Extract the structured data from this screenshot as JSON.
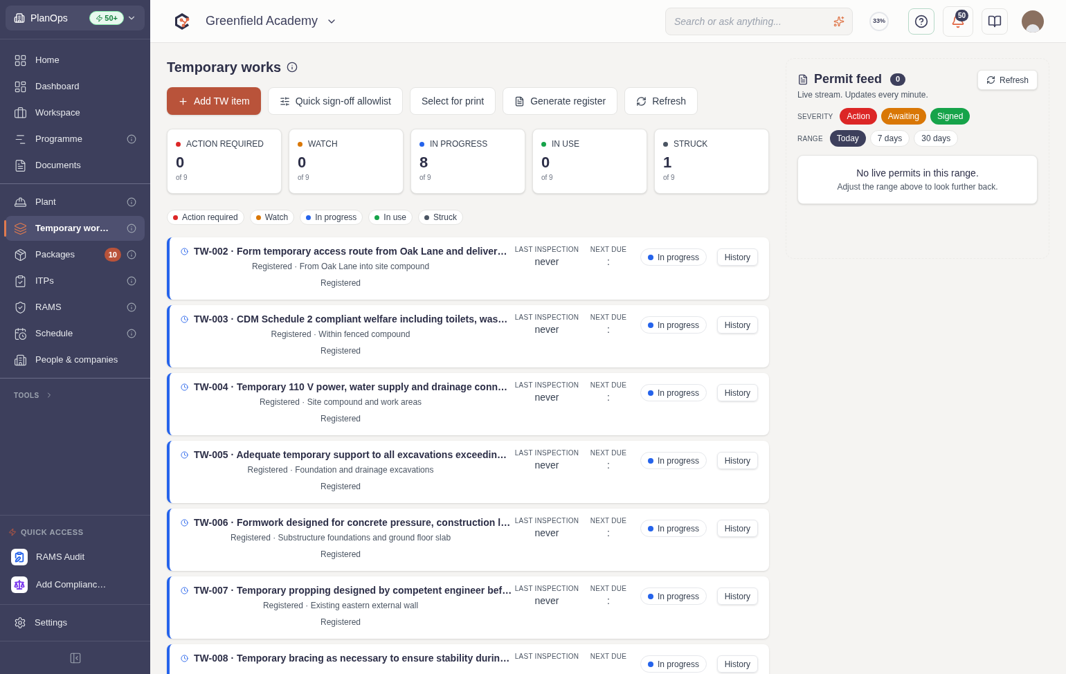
{
  "sidebar": {
    "org": "PlanOps",
    "org_badge": "50+",
    "nav_groups": [
      [
        {
          "label": "Home",
          "info": false,
          "selected": false
        },
        {
          "label": "Dashboard",
          "info": false,
          "selected": false
        },
        {
          "label": "Workspace",
          "info": false,
          "selected": false
        },
        {
          "label": "Programme",
          "info": true,
          "selected": false
        },
        {
          "label": "Documents",
          "info": false,
          "selected": false
        }
      ],
      [
        {
          "label": "Plant",
          "info": true,
          "selected": false
        },
        {
          "label": "Temporary wor…",
          "info": true,
          "selected": true
        },
        {
          "label": "Packages",
          "info": true,
          "selected": false,
          "badge": "10"
        },
        {
          "label": "ITPs",
          "info": true,
          "selected": false
        },
        {
          "label": "RAMS",
          "info": true,
          "selected": false
        },
        {
          "label": "Schedule",
          "info": true,
          "selected": false
        },
        {
          "label": "People & companies",
          "info": false,
          "selected": false
        }
      ]
    ],
    "tools_label": "TOOLS",
    "quick_access_label": "QUICK ACCESS",
    "quick_access": [
      {
        "label": "RAMS Audit",
        "color": "#2563eb"
      },
      {
        "label": "Add Complianc…",
        "color": "#7c3aed"
      }
    ],
    "settings": "Settings"
  },
  "header": {
    "project": "Greenfield Academy",
    "search": {
      "placeholder": "Search or ask anything..."
    },
    "progress": "33%",
    "notifications": "50"
  },
  "page": {
    "title": "Temporary works",
    "actions": [
      {
        "label": "Add TW item",
        "kind": "primary"
      },
      {
        "label": "Quick sign-off allowlist",
        "kind": "secondary"
      },
      {
        "label": "Select for print",
        "kind": "secondary"
      },
      {
        "label": "Generate register",
        "kind": "secondary"
      },
      {
        "label": "Refresh",
        "kind": "secondary"
      }
    ],
    "stats": [
      {
        "label": "ACTION REQUIRED",
        "value": "0",
        "total": "of 9",
        "color": "#dc2626"
      },
      {
        "label": "WATCH",
        "value": "0",
        "total": "of 9",
        "color": "#d97706"
      },
      {
        "label": "IN PROGRESS",
        "value": "8",
        "total": "of 9",
        "color": "#2563eb"
      },
      {
        "label": "IN USE",
        "value": "0",
        "total": "of 9",
        "color": "#16a34a"
      },
      {
        "label": "STRUCK",
        "value": "1",
        "total": "of 9",
        "color": "#4b5563"
      }
    ],
    "filters": [
      {
        "label": "Action required",
        "color": "#dc2626"
      },
      {
        "label": "Watch",
        "color": "#d97706"
      },
      {
        "label": "In progress",
        "color": "#2563eb"
      },
      {
        "label": "In use",
        "color": "#16a34a"
      },
      {
        "label": "Struck",
        "color": "#4b5563"
      }
    ],
    "items": [
      {
        "title": "TW-002 · Form temporary access route from Oak Lane and deliver…",
        "subtitle": "Registered · From Oak Lane into site compound",
        "stage": "Registered",
        "last_label": "LAST INSPECTION",
        "last": "never",
        "next_label": "NEXT DUE",
        "next": ":",
        "status": "In progress",
        "history": "History"
      },
      {
        "title": "TW-003 · CDM Schedule 2 compliant welfare including toilets, was…",
        "subtitle": "Registered · Within fenced compound",
        "stage": "Registered",
        "last_label": "LAST INSPECTION",
        "last": "never",
        "next_label": "NEXT DUE",
        "next": ":",
        "status": "In progress",
        "history": "History"
      },
      {
        "title": "TW-004 · Temporary 110 V power, water supply and drainage conn…",
        "subtitle": "Registered · Site compound and work areas",
        "stage": "Registered",
        "last_label": "LAST INSPECTION",
        "last": "never",
        "next_label": "NEXT DUE",
        "next": ":",
        "status": "In progress",
        "history": "History"
      },
      {
        "title": "TW-005 · Adequate temporary support to all excavations exceedin…",
        "subtitle": "Registered · Foundation and drainage excavations",
        "stage": "Registered",
        "last_label": "LAST INSPECTION",
        "last": "never",
        "next_label": "NEXT DUE",
        "next": ":",
        "status": "In progress",
        "history": "History"
      },
      {
        "title": "TW-006 · Formwork designed for concrete pressure, construction l…",
        "subtitle": "Registered · Substructure foundations and ground floor slab",
        "stage": "Registered",
        "last_label": "LAST INSPECTION",
        "last": "never",
        "next_label": "NEXT DUE",
        "next": ":",
        "status": "In progress",
        "history": "History"
      },
      {
        "title": "TW-007 · Temporary propping designed by competent engineer bef…",
        "subtitle": "Registered · Existing eastern external wall",
        "stage": "Registered",
        "last_label": "LAST INSPECTION",
        "last": "never",
        "next_label": "NEXT DUE",
        "next": ":",
        "status": "In progress",
        "history": "History"
      },
      {
        "title": "TW-008 · Temporary bracing as necessary to ensure stability durin…",
        "last_label": "LAST INSPECTION",
        "next_label": "NEXT DUE",
        "status": "In progress",
        "history": "History"
      }
    ]
  },
  "permit_feed": {
    "title": "Permit feed",
    "count": "0",
    "subtitle": "Live stream. Updates every minute.",
    "refresh": "Refresh",
    "severity_label": "SEVERITY",
    "severities": [
      {
        "label": "Action",
        "color": "#dc2626"
      },
      {
        "label": "Awaiting",
        "color": "#d97706"
      },
      {
        "label": "Signed",
        "color": "#16a34a"
      }
    ],
    "range_label": "RANGE",
    "ranges": [
      {
        "label": "Today",
        "selected": true
      },
      {
        "label": "7 days",
        "selected": false
      },
      {
        "label": "30 days",
        "selected": false
      }
    ],
    "empty_title": "No live permits in this range.",
    "empty_text": "Adjust the range above to look further back."
  }
}
